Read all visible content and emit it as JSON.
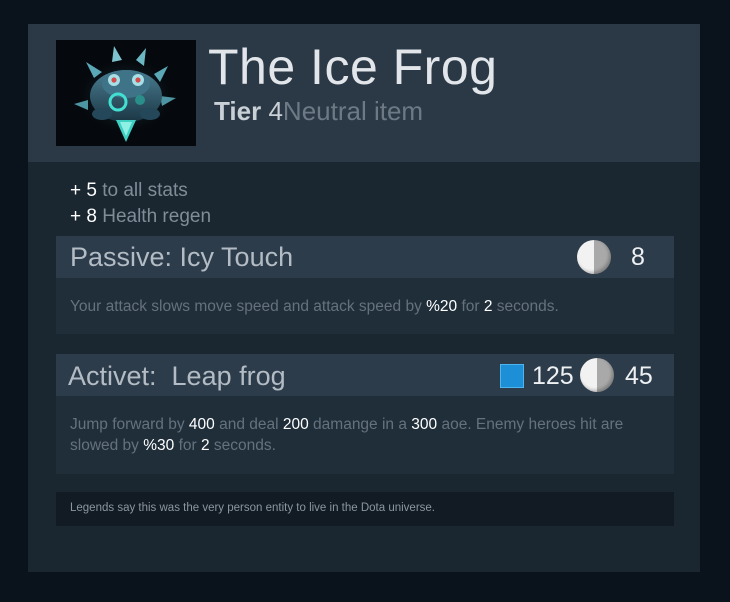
{
  "item": {
    "name": "The Ice Frog",
    "tier_word": "Tier",
    "tier_number": "4",
    "type": "Neutral item",
    "icon": "ice-frog-icon"
  },
  "stats": [
    {
      "value": "+ 5",
      "label": "to all stats"
    },
    {
      "value": "+ 8",
      "label": "Health regen"
    }
  ],
  "passive": {
    "title": "Passive: Icy Touch",
    "cooldown": "8",
    "cooldown_icon": "cooldown-icon",
    "description": {
      "t1": "Your attack slows move speed and attack speed by ",
      "v1": "%20",
      "t2": " for ",
      "v2": "2",
      "t3": " seconds."
    }
  },
  "active": {
    "title": "Activet:  Leap frog",
    "mana_cost": "125",
    "mana_icon": "mana-icon",
    "cooldown": "45",
    "cooldown_icon": "cooldown-icon",
    "description": {
      "t1": "Jump forward by ",
      "v1": "400",
      "t2": " and deal ",
      "v2": "200",
      "t3": " damange in a ",
      "v3": "300",
      "t4": " aoe. Enemy heroes hit are slowed by ",
      "v4": "%30",
      "t5": " for ",
      "v5": "2",
      "t6": " seconds."
    }
  },
  "lore": "Legends say this was the very person entity to live in the Dota universe.",
  "colors": {
    "background": "#0a121b",
    "card": "#1a2630",
    "header": "#2b3946",
    "mana": "#1d8fd6"
  }
}
